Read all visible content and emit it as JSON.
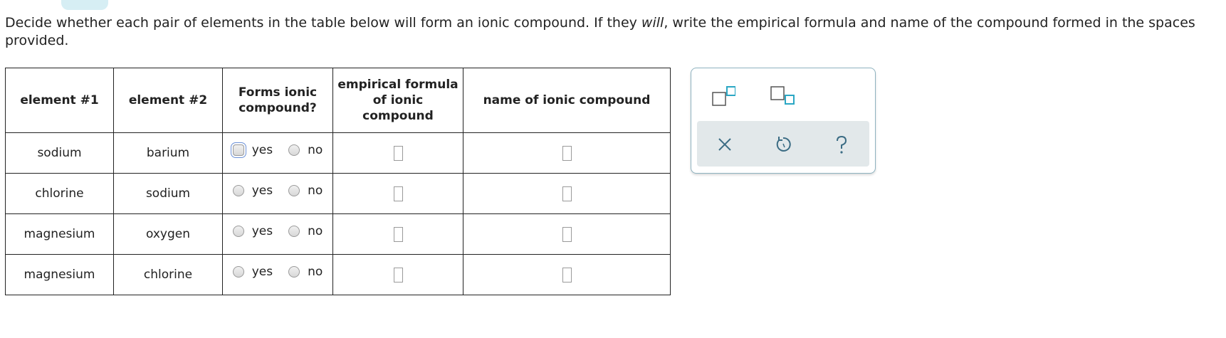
{
  "instructions": {
    "before": "Decide whether each pair of elements in the table below will form an ionic compound. If they ",
    "emph": "will",
    "after": ", write the empirical formula and name of the compound formed in the spaces provided."
  },
  "table": {
    "headers": {
      "element1": "element #1",
      "element2": "element #2",
      "forms": "Forms ionic compound?",
      "formula": "empirical formula of ionic compound",
      "name": "name of ionic compound"
    },
    "rows": [
      {
        "element1": "sodium",
        "element2": "barium",
        "yes": "yes",
        "no": "no",
        "formula": "",
        "name": ""
      },
      {
        "element1": "chlorine",
        "element2": "sodium",
        "yes": "yes",
        "no": "no",
        "formula": "",
        "name": ""
      },
      {
        "element1": "magnesium",
        "element2": "oxygen",
        "yes": "yes",
        "no": "no",
        "formula": "",
        "name": ""
      },
      {
        "element1": "magnesium",
        "element2": "chlorine",
        "yes": "yes",
        "no": "no",
        "formula": "",
        "name": ""
      }
    ]
  },
  "tools": {
    "superscript_icon": "superscript-icon",
    "subscript_icon": "subscript-icon",
    "clear_icon": "close-icon",
    "undo_icon": "undo-icon",
    "help_icon": "help-icon",
    "accent_color": "#2ba7c4"
  }
}
